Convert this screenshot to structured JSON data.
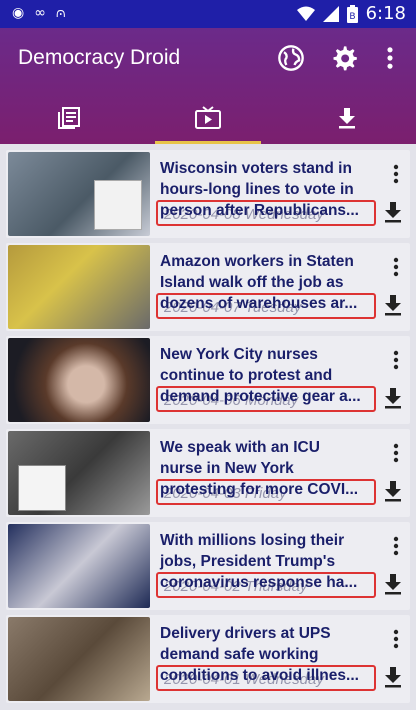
{
  "status_bar": {
    "time": "6:18",
    "icons": [
      "notification-dot-icon",
      "infinity-icon",
      "graduation-cap-icon",
      "wifi-icon",
      "signal-icon",
      "battery-icon"
    ]
  },
  "app_bar": {
    "title": "Democracy Droid",
    "actions": [
      "globe-icon",
      "gear-icon",
      "more-vert-icon"
    ]
  },
  "tabs": [
    {
      "icon": "articles-icon",
      "active": false
    },
    {
      "icon": "tv-icon",
      "active": true
    },
    {
      "icon": "download-icon",
      "active": false
    }
  ],
  "colors": {
    "status_bar": "#1f1fa8",
    "app_bar": "#6b2a8a",
    "tab_indicator": "#e8c44a",
    "title_text": "#1a1f6a"
  },
  "items": [
    {
      "title_line1": "Wisconsin voters stand in",
      "title_line2": "hours-long lines to vote in",
      "title_line3": "person after Republicans...",
      "date": "2020-04-08 Wednesday",
      "thumb_bg": "#5a6b7a"
    },
    {
      "title_line1": "Amazon workers in Staten",
      "title_line2": "Island walk off the job as",
      "title_line3": "dozens of warehouses ar...",
      "date": "2020-04-07 Tuesday",
      "thumb_bg": "#8a7a3a"
    },
    {
      "title_line1": "New York City nurses",
      "title_line2": "continue to protest and",
      "title_line3": "demand protective gear a...",
      "date": "2020-04-06 Monday",
      "thumb_bg": "#3a2a2a"
    },
    {
      "title_line1": "We speak with an ICU",
      "title_line2": "nurse in New York",
      "title_line3": "protesting for more COVI...",
      "date": "2020-04-03 Friday",
      "thumb_bg": "#4a4a4a"
    },
    {
      "title_line1": "With millions losing their",
      "title_line2": "jobs, President Trump's",
      "title_line3": "coronavirus response ha...",
      "date": "2020-04-02 Thursday",
      "thumb_bg": "#2a3a6a"
    },
    {
      "title_line1": "Delivery drivers at UPS",
      "title_line2": "demand safe working",
      "title_line3": "conditions to avoid illnes...",
      "date": "2020-04-01 Wednesday",
      "thumb_bg": "#6a5a4a"
    }
  ]
}
